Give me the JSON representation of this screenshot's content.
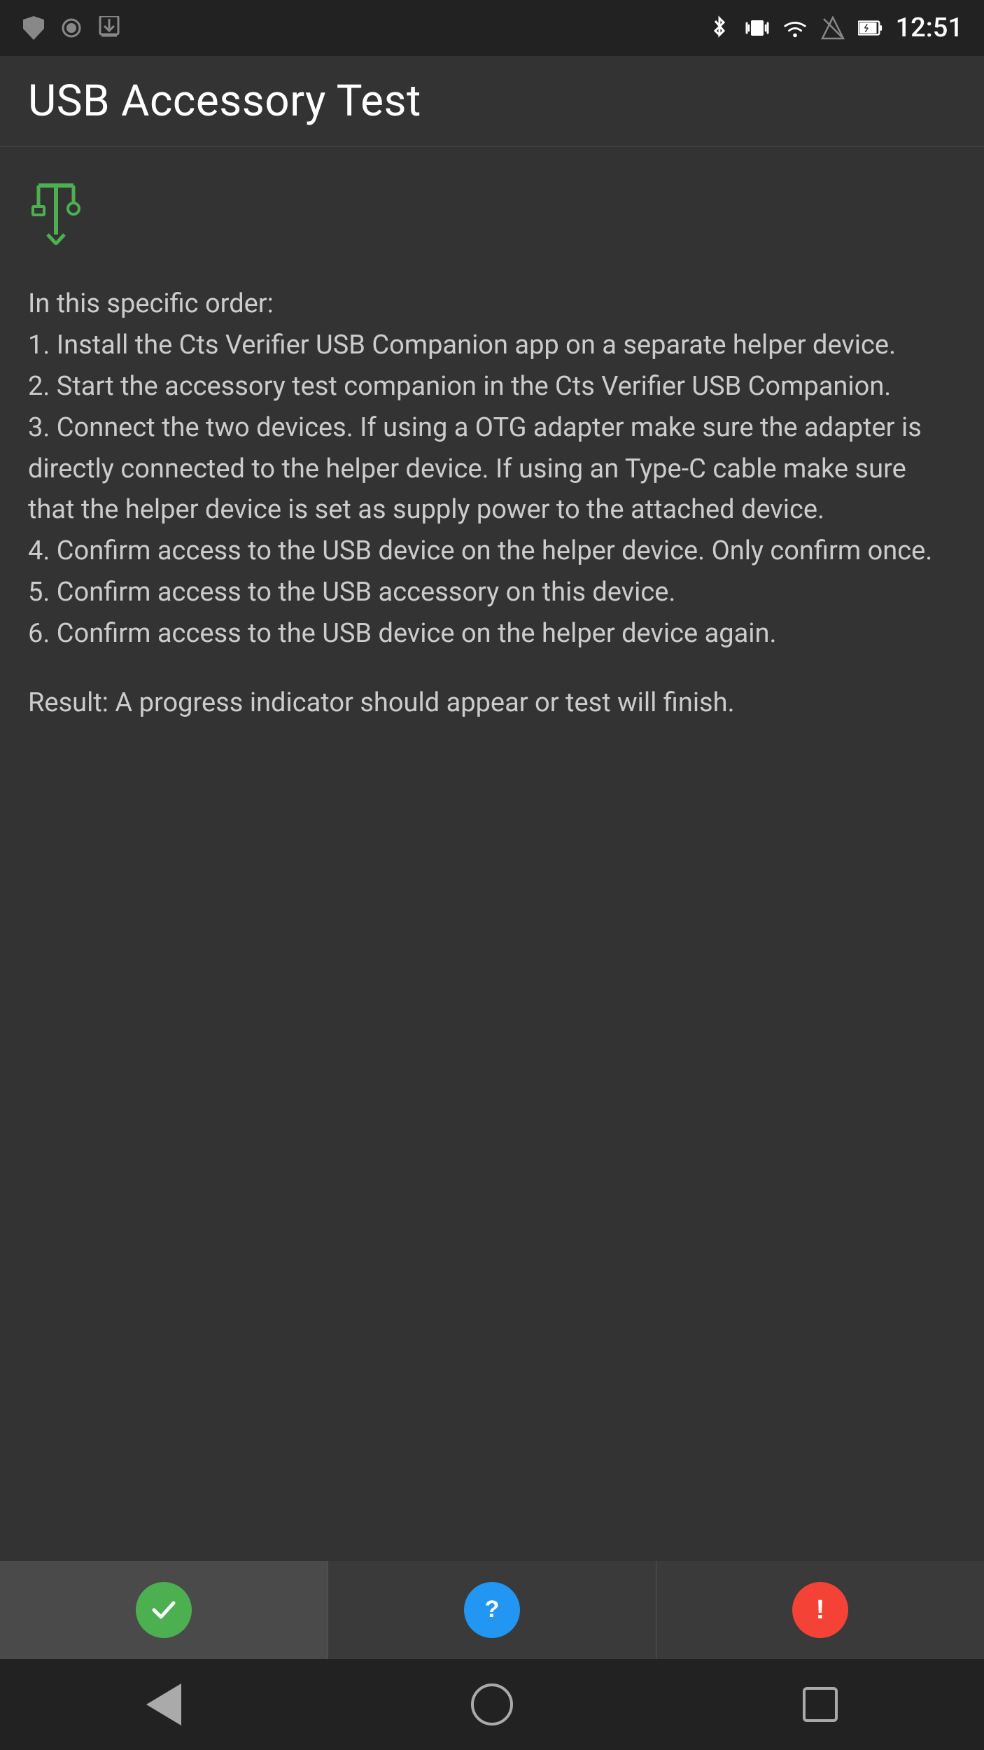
{
  "statusBar": {
    "time": "12:51",
    "leftIcons": [
      "shield",
      "record",
      "download"
    ],
    "rightIcons": [
      "bluetooth",
      "vibrate",
      "wifi",
      "signal",
      "battery"
    ]
  },
  "appBar": {
    "title": "USB Accessory Test"
  },
  "content": {
    "usbIconSymbol": "✦",
    "instructions": "In this specific order:\n1. Install the Cts Verifier USB Companion app on a separate helper device.\n2. Start the accessory test companion in the Cts Verifier USB Companion.\n3. Connect the two devices. If using a OTG adapter make sure the adapter is directly connected to the helper device. If using an Type-C cable make sure that the helper device is set as supply power to the attached device.\n4. Confirm access to the USB device on the helper device. Only confirm once.\n5. Confirm access to the USB accessory on this device.\n6. Confirm access to the USB device on the helper device again.",
    "result": "Result: A progress indicator should appear or test will finish."
  },
  "bottomActions": {
    "passLabel": "✓",
    "infoLabel": "?",
    "failLabel": "!"
  },
  "systemNav": {
    "backLabel": "◀",
    "homeLabel": "○",
    "recentsLabel": "□"
  }
}
